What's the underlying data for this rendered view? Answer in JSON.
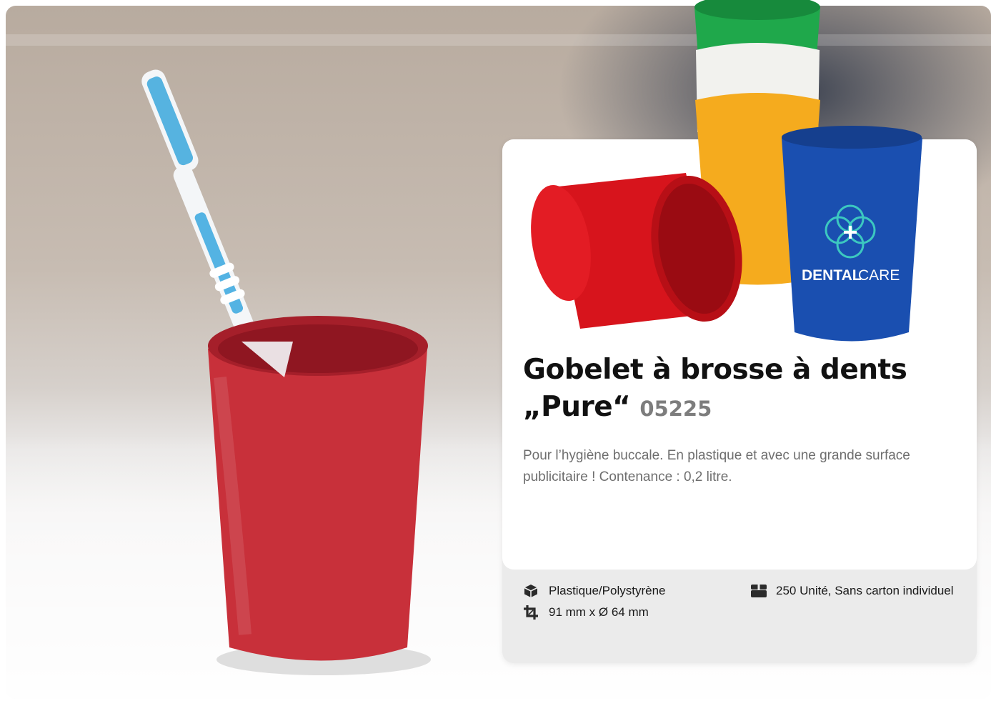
{
  "product": {
    "title": "Gobelet à brosse à dents „Pure“",
    "article_number": "05225",
    "description": "Pour l’hygiène buccale. En plastique et avec une grande surface publicitaire ! Contenance : 0,2 litre.",
    "brand_print": {
      "part1": "DENTAL",
      "part2": "CARE"
    }
  },
  "specs": {
    "material": {
      "icon": "box-icon",
      "text": "Plastique/Polystyrène"
    },
    "dimensions": {
      "icon": "crop-icon",
      "text": "91 mm x Ø 64 mm"
    },
    "packaging": {
      "icon": "package-icon",
      "text": "250 Unité, Sans carton individuel"
    }
  },
  "colors": {
    "cup_red": "#d7141c",
    "cup_green": "#1fa84b",
    "cup_white": "#f2f2ee",
    "cup_yellow": "#f5ab1e",
    "cup_blue": "#1a4fb0",
    "logo_teal": "#3cc8c0"
  }
}
